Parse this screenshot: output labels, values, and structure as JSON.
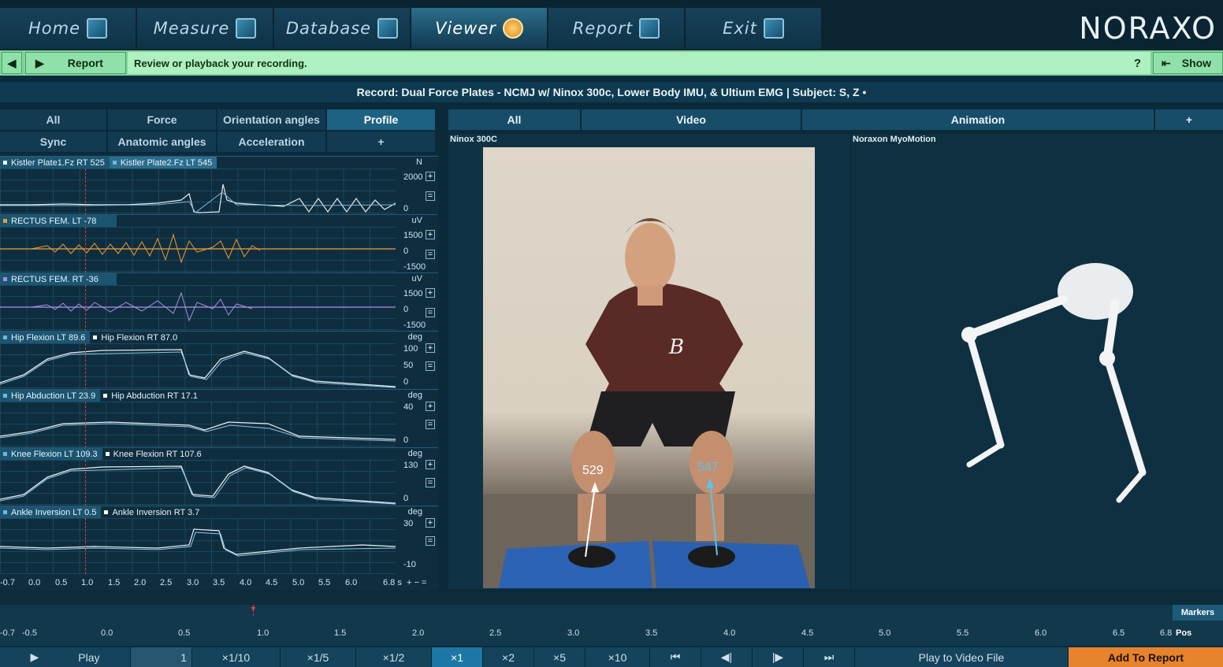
{
  "nav": {
    "tabs": [
      {
        "label": "Home",
        "icon": "house-icon"
      },
      {
        "label": "Measure",
        "icon": "measure-icon"
      },
      {
        "label": "Database",
        "icon": "database-icon"
      },
      {
        "label": "Viewer",
        "icon": "viewer-icon"
      },
      {
        "label": "Report",
        "icon": "report-icon"
      },
      {
        "label": "Exit",
        "icon": "exit-arrow-icon"
      }
    ],
    "active": "Viewer",
    "logo": "NORAXO"
  },
  "toolbar": {
    "back_icon": "step-back-icon",
    "forward_icon": "step-forward-icon",
    "report_label": "Report",
    "instruction": "Review or playback your recording.",
    "help_label": "?",
    "show_label": "Show",
    "accent": "#7fd39a"
  },
  "record": {
    "title": "Record: Dual Force Plates - NCMJ w/ Ninox 300c, Lower Body IMU, & Ultium EMG | Subject: S, Z •"
  },
  "left_tabs": {
    "row1": [
      "All",
      "Force",
      "Orientation angles",
      "Profile"
    ],
    "row2": [
      "Sync",
      "Anatomic angles",
      "Acceleration",
      "+"
    ],
    "active": "Profile"
  },
  "channels": [
    {
      "labels": [
        "Kistler Plate1.Fz RT  525",
        "Kistler Plate2.Fz LT  545"
      ],
      "unit": "N",
      "ticks": [
        "2000",
        "0"
      ]
    },
    {
      "labels": [
        "RECTUS FEM. LT  -78"
      ],
      "unit": "uV",
      "ticks": [
        "1500",
        "0",
        "-1500"
      ]
    },
    {
      "labels": [
        "RECTUS FEM. RT  -36"
      ],
      "unit": "uV",
      "ticks": [
        "1500",
        "0",
        "-1500"
      ]
    },
    {
      "labels": [
        "Hip Flexion LT  89.6",
        "Hip Flexion RT  87.0"
      ],
      "unit": "deg",
      "ticks": [
        "100",
        "50",
        "0"
      ]
    },
    {
      "labels": [
        "Hip Abduction LT  23.9",
        "Hip Abduction RT  17.1"
      ],
      "unit": "deg",
      "ticks": [
        "40",
        "0"
      ]
    },
    {
      "labels": [
        "Knee Flexion LT  109.3",
        "Knee Flexion RT  107.6"
      ],
      "unit": "deg",
      "ticks": [
        "130",
        "0"
      ]
    },
    {
      "labels": [
        "Ankle Inversion LT  0.5",
        "Ankle Inversion RT  3.7"
      ],
      "unit": "deg",
      "ticks": [
        "30",
        "-10"
      ]
    }
  ],
  "chart_xaxis": [
    "-0.7",
    "0.0",
    "0.5",
    "1.0",
    "1.5",
    "2.0",
    "2.5",
    "3.0",
    "3.5",
    "4.0",
    "4.5",
    "5.0",
    "5.5",
    "6.0",
    "6.8 s"
  ],
  "viewer_tabs": [
    "All",
    "Video",
    "Animation",
    "+"
  ],
  "video": {
    "title": "Ninox 300C",
    "force_left": "529",
    "force_right": "547"
  },
  "animation": {
    "title": "Noraxon MyoMotion"
  },
  "timeline": {
    "ticks": [
      "-0.7",
      "-0.5",
      "0.0",
      "0.5",
      "1.0",
      "1.5",
      "2.0",
      "2.5",
      "3.0",
      "3.5",
      "4.0",
      "4.5",
      "5.0",
      "5.5",
      "6.0",
      "6.5",
      "6.8"
    ],
    "markers_label": "Markers",
    "pos_label": "Pos"
  },
  "playbar": {
    "play_label": "Play",
    "frame_value": "1",
    "speeds": [
      "×1/10",
      "×1/5",
      "×1/2",
      "×1",
      "×2",
      "×5",
      "×10"
    ],
    "active_speed": "×1",
    "nav_icons": [
      "skip-to-start-icon",
      "step-back-frame-icon",
      "step-forward-frame-icon",
      "skip-to-end-icon"
    ],
    "video_label": "Play to Video File",
    "add_report_label": "Add To Report"
  }
}
